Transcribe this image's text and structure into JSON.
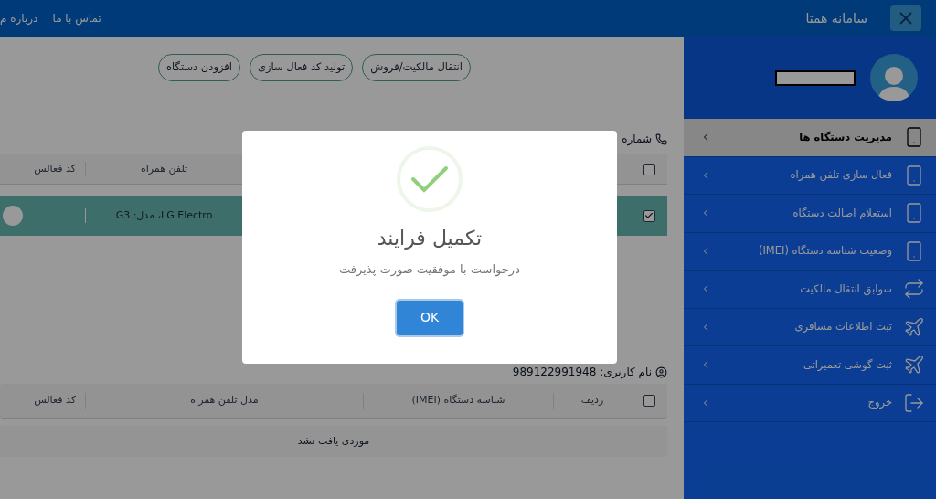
{
  "header": {
    "title": "سامانه همتا",
    "links": [
      "تماس با ما",
      "درباره م"
    ]
  },
  "sidebar": {
    "items": [
      {
        "label": "مدیریت دستگاه ها",
        "selected": true
      },
      {
        "label": "فعال سازی تلفن همراه",
        "selected": false
      },
      {
        "label": "استعلام اصالت دستگاه",
        "selected": false
      },
      {
        "label": "وضعیت شناسه دستگاه (IMEI)",
        "selected": false
      },
      {
        "label": "سوابق انتقال مالکیت",
        "selected": false
      },
      {
        "label": "ثبت اطلاعات مسافری",
        "selected": false
      },
      {
        "label": "ثبت گوشی تعمیراتی",
        "selected": false
      },
      {
        "label": "خروج",
        "selected": false
      }
    ]
  },
  "toolbar": {
    "buttons": [
      "انتقال مالکیت/فروش",
      "تولید کد فعال سازی",
      "افزودن دستگاه"
    ]
  },
  "device_section": {
    "label": "شماره",
    "table": {
      "header_checked": false,
      "columns": [
        "تلفن همراه",
        "کد فعالس"
      ],
      "rows": [
        {
          "checked": true,
          "model": "LG Electro، مدل: G3",
          "toggle_on": false
        }
      ]
    }
  },
  "user_section": {
    "label": "نام کاربری: 989122991948",
    "table": {
      "header_checked": false,
      "columns": [
        "ردیف",
        "شناسه دستگاه (IMEI)",
        "مدل تلفن همراه",
        "کد فعالس"
      ],
      "empty_message": "موردی یافت نشد"
    }
  },
  "dialog": {
    "title": "تکمیل فرایند",
    "message": "درخواست با موفقیت صورت پذیرفت",
    "button": "OK"
  }
}
